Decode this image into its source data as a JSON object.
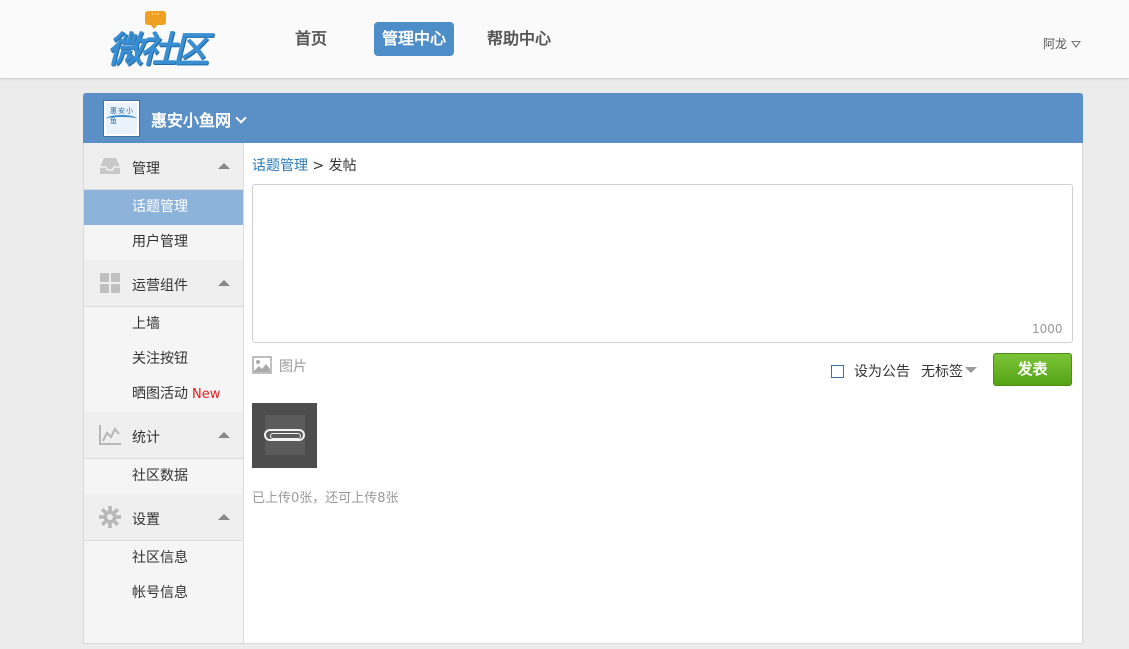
{
  "header": {
    "logo_text": "微社区",
    "logo_bubble": "···",
    "nav": [
      "首页",
      "管理中心",
      "帮助中心"
    ],
    "active_nav": "管理中心",
    "user_name": "阿龙"
  },
  "community": {
    "name": "惠安小鱼网",
    "avatar_text": "惠安小鱼"
  },
  "sidebar": {
    "groups": [
      {
        "label": "管理",
        "icon": "inbox-icon",
        "items": [
          {
            "label": "话题管理",
            "active": true
          },
          {
            "label": "用户管理"
          }
        ]
      },
      {
        "label": "运营组件",
        "icon": "grid-icon",
        "items": [
          {
            "label": "上墙"
          },
          {
            "label": "关注按钮"
          },
          {
            "label": "晒图活动",
            "badge": "New"
          }
        ]
      },
      {
        "label": "统计",
        "icon": "chart-icon",
        "items": [
          {
            "label": "社区数据"
          }
        ]
      },
      {
        "label": "设置",
        "icon": "gear-icon",
        "items": [
          {
            "label": "社区信息"
          },
          {
            "label": "帐号信息"
          }
        ]
      }
    ]
  },
  "content": {
    "breadcrumb": {
      "link": "话题管理",
      "separator": ">",
      "current": "发帖"
    },
    "editor": {
      "value": "",
      "counter": "1000"
    },
    "image_toggle_label": "图片",
    "announce_label": "设为公告",
    "tag_label": "无标签",
    "publish_label": "发表",
    "upload_hint": "已上传0张，还可上传8张"
  },
  "colors": {
    "header_bg": "#fafafa",
    "nav_active": "#4d8dc8",
    "community_bar": "#5b90c6",
    "sidebar_active": "#8db3db",
    "publish_green": "#6cb529",
    "link": "#2a7ab8",
    "new_badge": "#e02020"
  }
}
